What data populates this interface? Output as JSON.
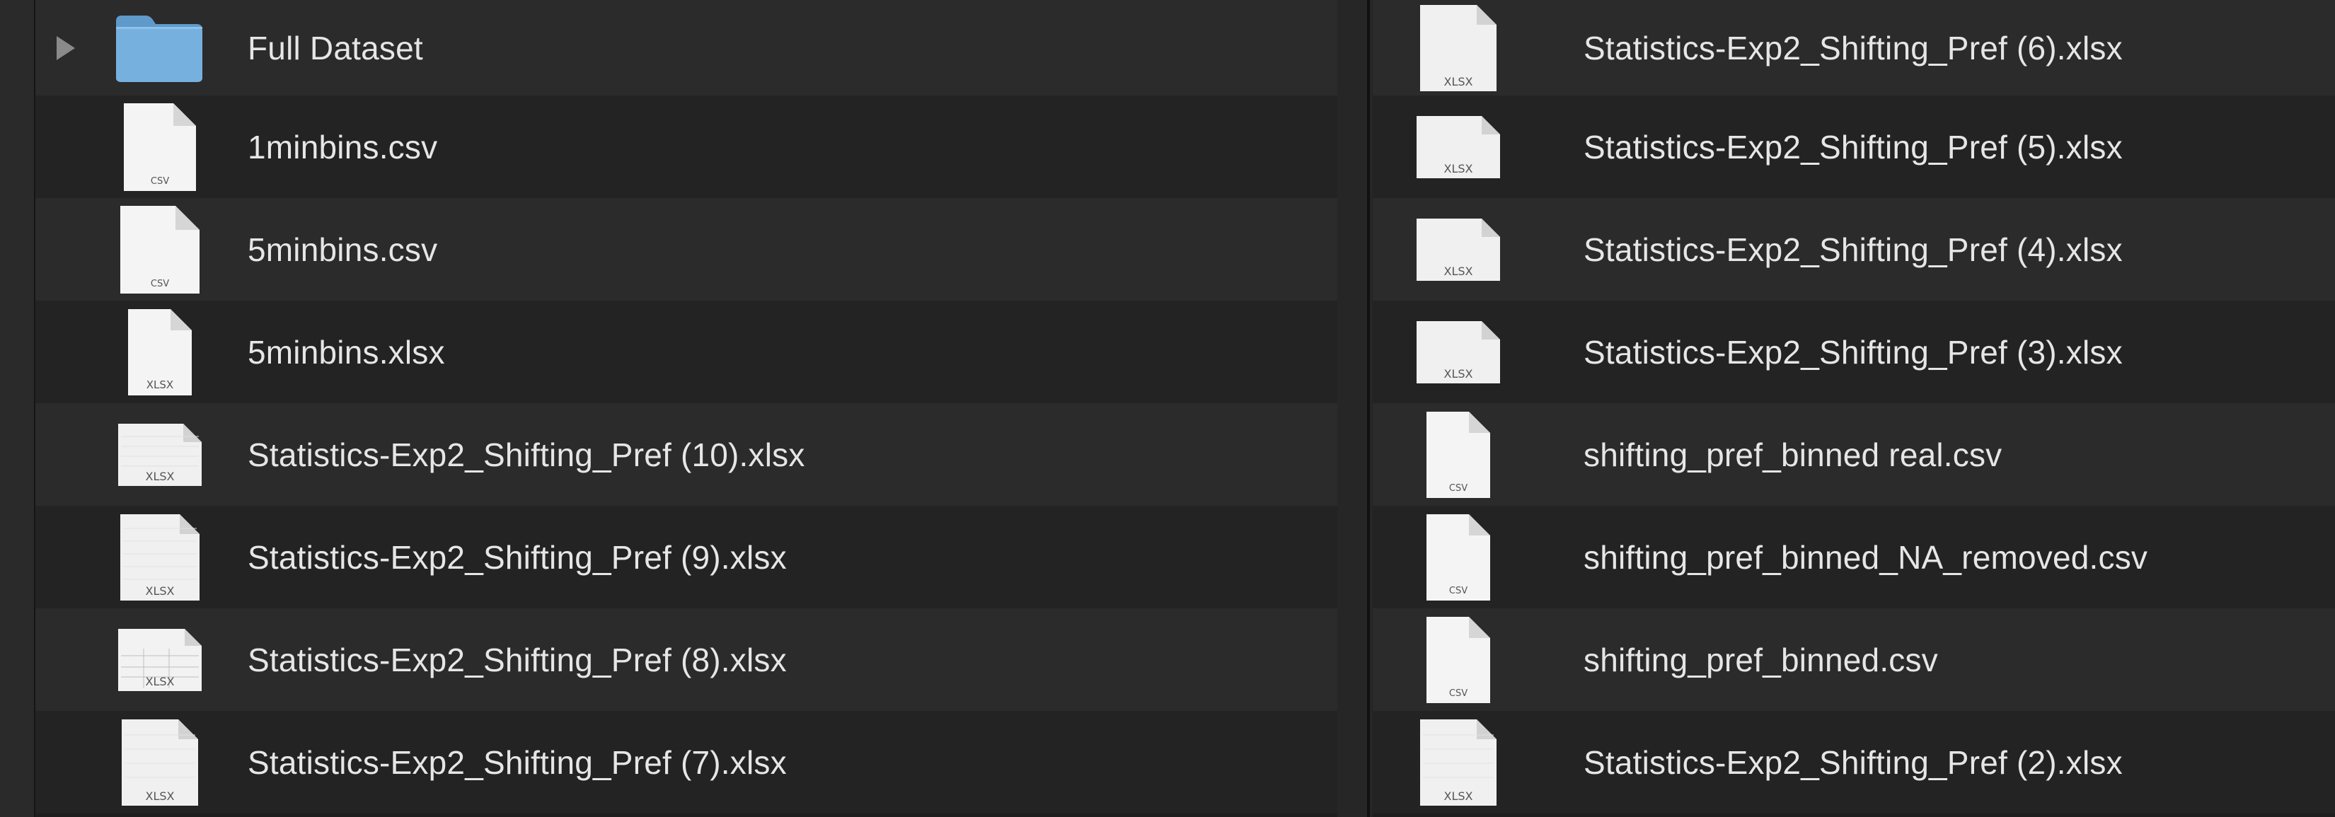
{
  "left_column": [
    {
      "name": "Full Dataset",
      "kind": "folder",
      "icon": "folder-icon",
      "expandable": true
    },
    {
      "name": "1minbins.csv",
      "kind": "CSV",
      "icon": "csv-file-icon"
    },
    {
      "name": "5minbins.csv",
      "kind": "CSV",
      "icon": "csv-file-icon"
    },
    {
      "name": "5minbins.xlsx",
      "kind": "XLSX",
      "icon": "xlsx-file-icon"
    },
    {
      "name": "Statistics-Exp2_Shifting_Pref (10).xlsx",
      "kind": "XLSX",
      "icon": "xlsx-file-icon"
    },
    {
      "name": "Statistics-Exp2_Shifting_Pref (9).xlsx",
      "kind": "XLSX",
      "icon": "xlsx-file-icon"
    },
    {
      "name": "Statistics-Exp2_Shifting_Pref (8).xlsx",
      "kind": "XLSX",
      "icon": "xlsx-file-icon"
    },
    {
      "name": "Statistics-Exp2_Shifting_Pref (7).xlsx",
      "kind": "XLSX",
      "icon": "xlsx-file-icon"
    }
  ],
  "right_column": [
    {
      "name": "Statistics-Exp2_Shifting_Pref (6).xlsx",
      "kind": "XLSX",
      "icon": "xlsx-file-icon"
    },
    {
      "name": "Statistics-Exp2_Shifting_Pref (5).xlsx",
      "kind": "XLSX",
      "icon": "xlsx-file-icon"
    },
    {
      "name": "Statistics-Exp2_Shifting_Pref (4).xlsx",
      "kind": "XLSX",
      "icon": "xlsx-file-icon"
    },
    {
      "name": "Statistics-Exp2_Shifting_Pref (3).xlsx",
      "kind": "XLSX",
      "icon": "xlsx-file-icon"
    },
    {
      "name": "shifting_pref_binned real.csv",
      "kind": "CSV",
      "icon": "csv-file-icon"
    },
    {
      "name": "shifting_pref_binned_NA_removed.csv",
      "kind": "CSV",
      "icon": "csv-file-icon"
    },
    {
      "name": "shifting_pref_binned.csv",
      "kind": "CSV",
      "icon": "csv-file-icon"
    },
    {
      "name": "Statistics-Exp2_Shifting_Pref (2).xlsx",
      "kind": "XLSX",
      "icon": "xlsx-file-icon"
    }
  ],
  "colors": {
    "background": "#1e1e1e",
    "row_light": "#2b2b2b",
    "row_dark": "#232323",
    "text": "#e6e6e6",
    "folder": "#6fa8d6",
    "doc_paper": "#f2f2f2"
  }
}
